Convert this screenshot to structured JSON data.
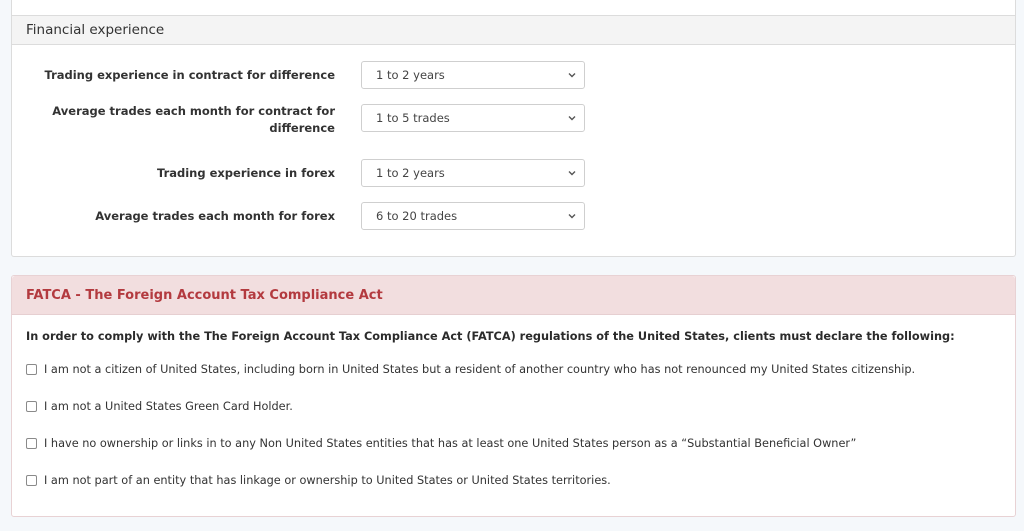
{
  "financial_experience": {
    "title": "Financial experience",
    "fields": [
      {
        "label": "Trading experience in contract for difference",
        "value": "1 to 2 years"
      },
      {
        "label": "Average trades each month for contract for difference",
        "value": "1 to 5 trades"
      },
      {
        "label": "Trading experience in forex",
        "value": "1 to 2 years"
      },
      {
        "label": "Average trades each month for forex",
        "value": "6 to 20 trades"
      }
    ]
  },
  "fatca": {
    "title": "FATCA - The Foreign Account Tax Compliance Act",
    "intro": "In order to comply with the The Foreign Account Tax Compliance Act (FATCA) regulations of the United States, clients must declare the following:",
    "declarations": [
      {
        "label": "I am not a citizen of United States, including born in United States but a resident of another country who has not renounced my United States citizenship.",
        "checked": false
      },
      {
        "label": "I am not a United States Green Card Holder.",
        "checked": false
      },
      {
        "label": "I have no ownership or links in to any Non United States entities that has at least one United States person as a “Substantial Beneficial Owner”",
        "checked": false
      },
      {
        "label": "I am not part of an entity that has linkage or ownership to United States or United States territories.",
        "checked": false
      }
    ]
  },
  "icons": {
    "select_chevron": "chevron-down-icon",
    "checkbox": "checkbox-unchecked-icon"
  },
  "colors": {
    "page_background": "#f5f8fb",
    "fatca_header_background": "#f2dedf",
    "fatca_header_text": "#b33a3f",
    "section_header_background": "#f4f4f4"
  }
}
